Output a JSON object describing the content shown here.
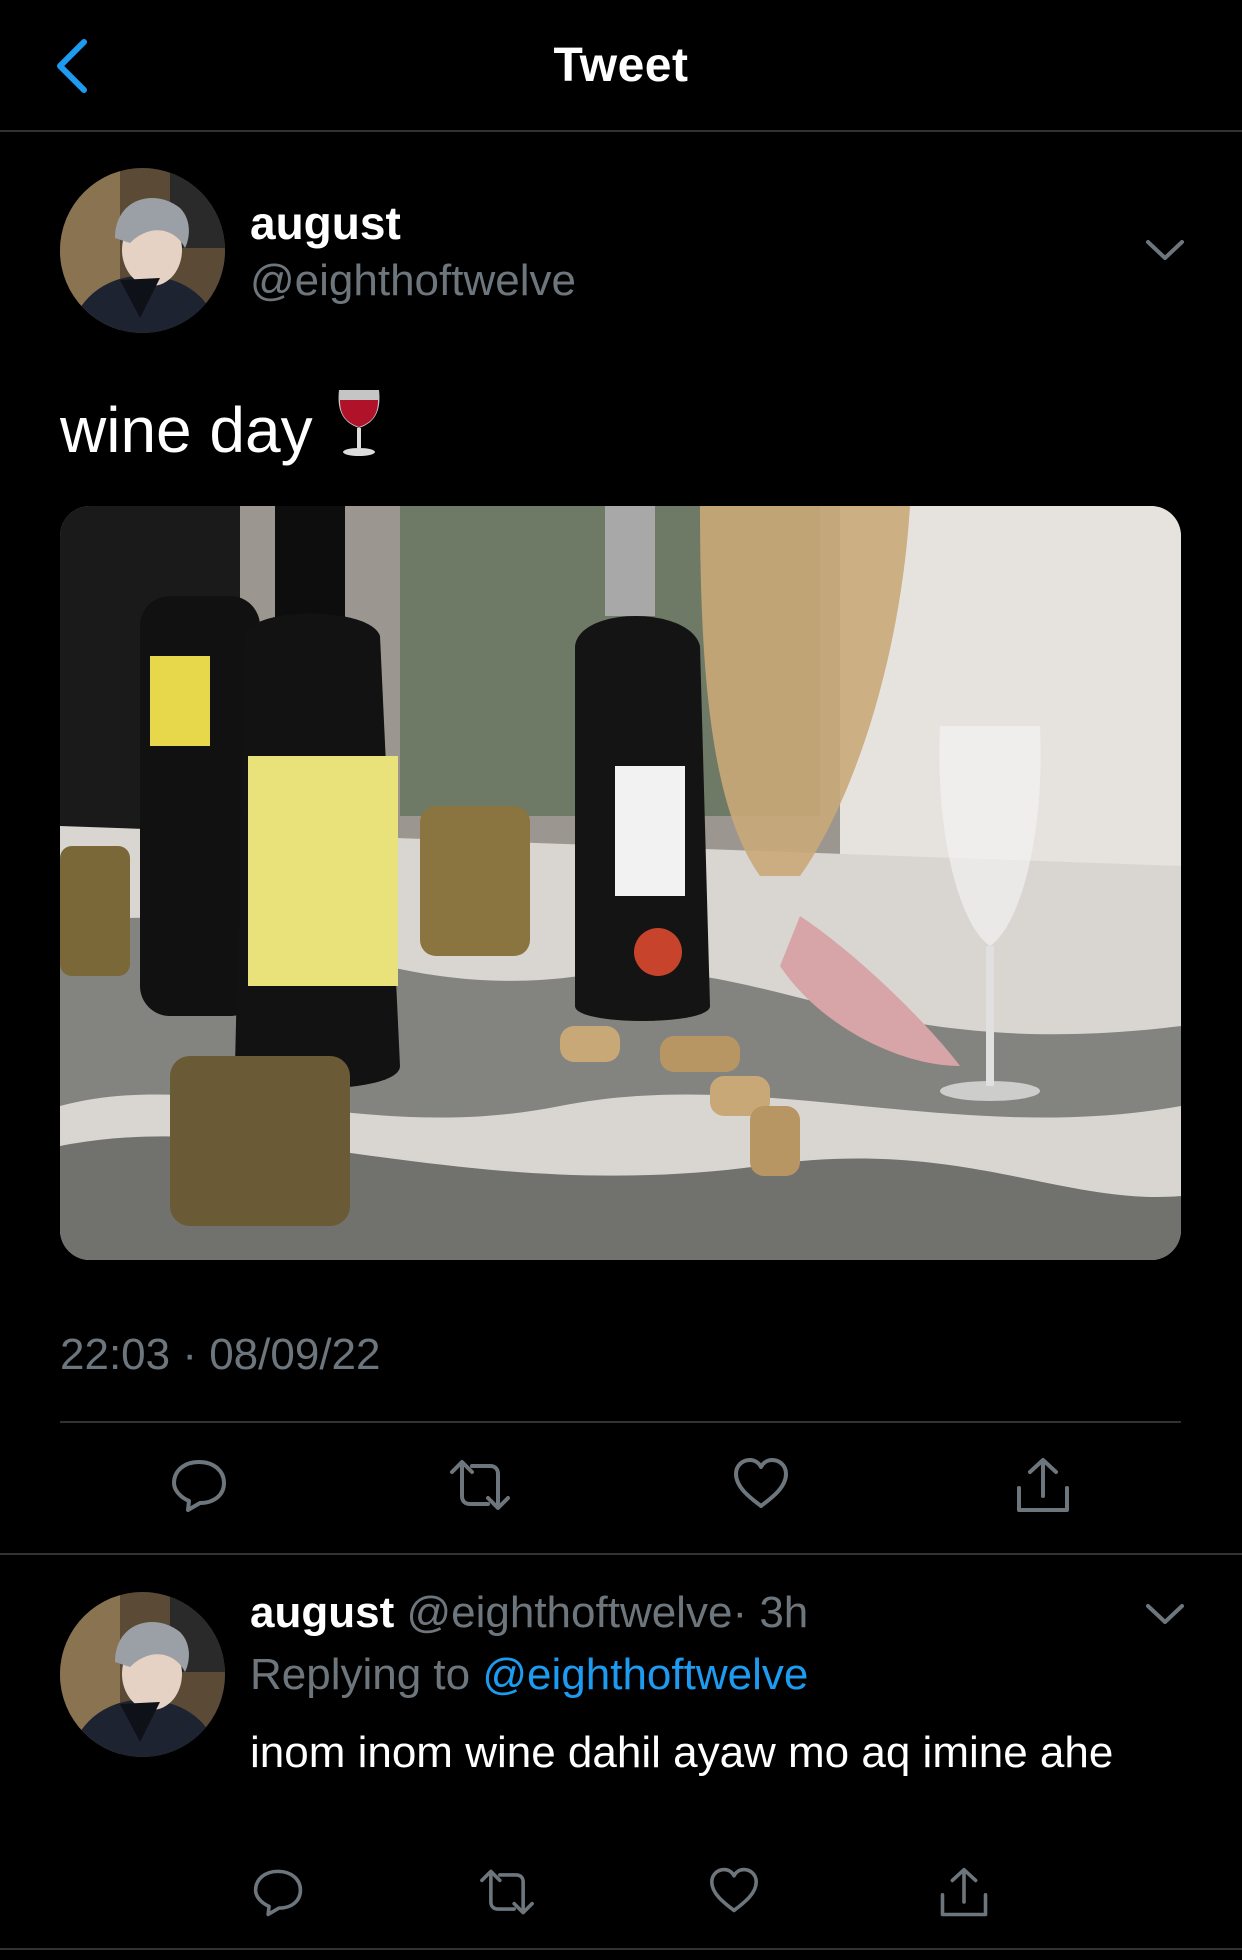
{
  "header": {
    "title": "Tweet",
    "back_icon": "chevron-left-icon"
  },
  "tweet": {
    "author": {
      "name": "august",
      "handle": "@eighthoftwelve"
    },
    "text": "wine day",
    "emoji": "wine-glass-icon",
    "media_description_icon": "photo",
    "timestamp": "22:03 · 08/09/22",
    "actions": [
      "reply-icon",
      "retweet-icon",
      "like-icon",
      "share-icon"
    ]
  },
  "reply": {
    "author": {
      "name": "august",
      "handle": "@eighthoftwelve"
    },
    "meta": "· 3h",
    "replying_prefix": "Replying to",
    "replying_to": "@eighthoftwelve",
    "text": "inom inom wine dahil ayaw mo aq imine ahe"
  },
  "colors": {
    "background": "#000000",
    "accent": "#1d9bf0",
    "muted": "#6e767d",
    "divider": "#2f3336"
  }
}
